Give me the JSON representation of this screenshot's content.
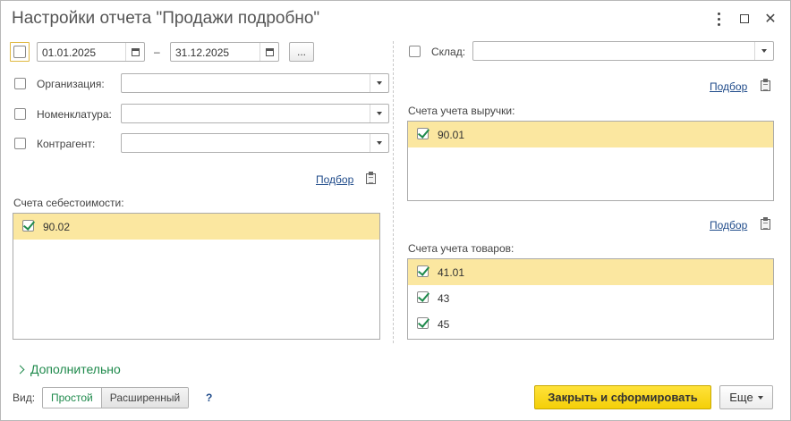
{
  "window": {
    "title": "Настройки отчета \"Продажи подробно\""
  },
  "period": {
    "from": "01.01.2025",
    "dash": "–",
    "to": "31.12.2025",
    "more_label": "..."
  },
  "filters": {
    "organization_label": "Организация:",
    "nomenclature_label": "Номенклатура:",
    "counterparty_label": "Контрагент:",
    "warehouse_label": "Склад:"
  },
  "cost_accounts": {
    "link": "Подбор",
    "title": "Счета себестоимости:",
    "items": [
      {
        "code": "90.02",
        "checked": true
      }
    ]
  },
  "revenue_accounts": {
    "link": "Подбор",
    "title": "Счета учета выручки:",
    "items": [
      {
        "code": "90.01",
        "checked": true
      }
    ]
  },
  "goods_accounts": {
    "link": "Подбор",
    "title": "Счета учета товаров:",
    "items": [
      {
        "code": "41.01",
        "checked": true
      },
      {
        "code": "43",
        "checked": true
      },
      {
        "code": "45",
        "checked": true
      }
    ]
  },
  "footer": {
    "more_section": "Дополнительно",
    "view_label": "Вид:",
    "view_simple": "Простой",
    "view_extended": "Расширенный",
    "help": "?",
    "primary_button": "Закрыть и сформировать",
    "more_button": "Еще"
  },
  "colors": {
    "accent_green": "#1f8a4c",
    "selection": "#fbe7a0",
    "primary_button": "#f4cf08",
    "link": "#1f4b8a"
  }
}
